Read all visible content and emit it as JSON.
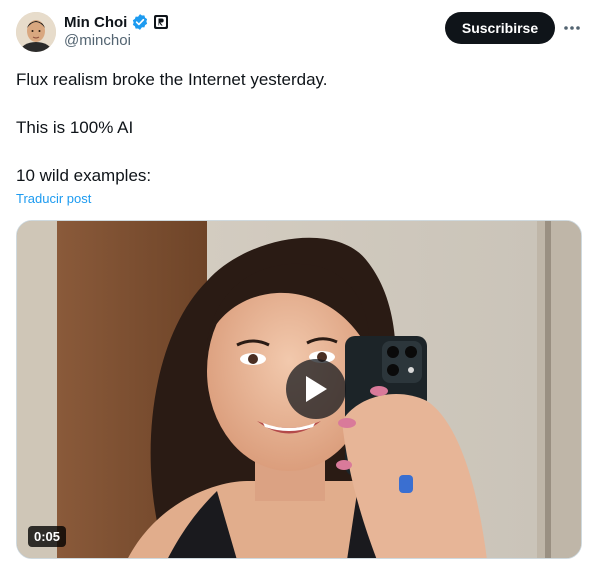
{
  "author": {
    "display_name": "Min Choi",
    "handle": "@minchoi",
    "avatar_icon": "avatar-photo",
    "verified_icon": "verified-badge-icon",
    "affiliate_icon": "affiliate-badge-icon"
  },
  "actions": {
    "subscribe_label": "Suscribirse",
    "more_icon": "more-options-icon"
  },
  "post": {
    "lines": [
      "Flux realism broke the Internet yesterday.",
      "This is 100% AI",
      "10 wild examples:"
    ],
    "translate_label": "Traducir post"
  },
  "media": {
    "type": "video",
    "duration": "0:05",
    "play_icon": "play-icon"
  },
  "colors": {
    "text": "#0f1419",
    "secondary_text": "#536471",
    "link": "#1d9bf0",
    "verified": "#1d9bf0",
    "button_bg": "#0f1419"
  }
}
